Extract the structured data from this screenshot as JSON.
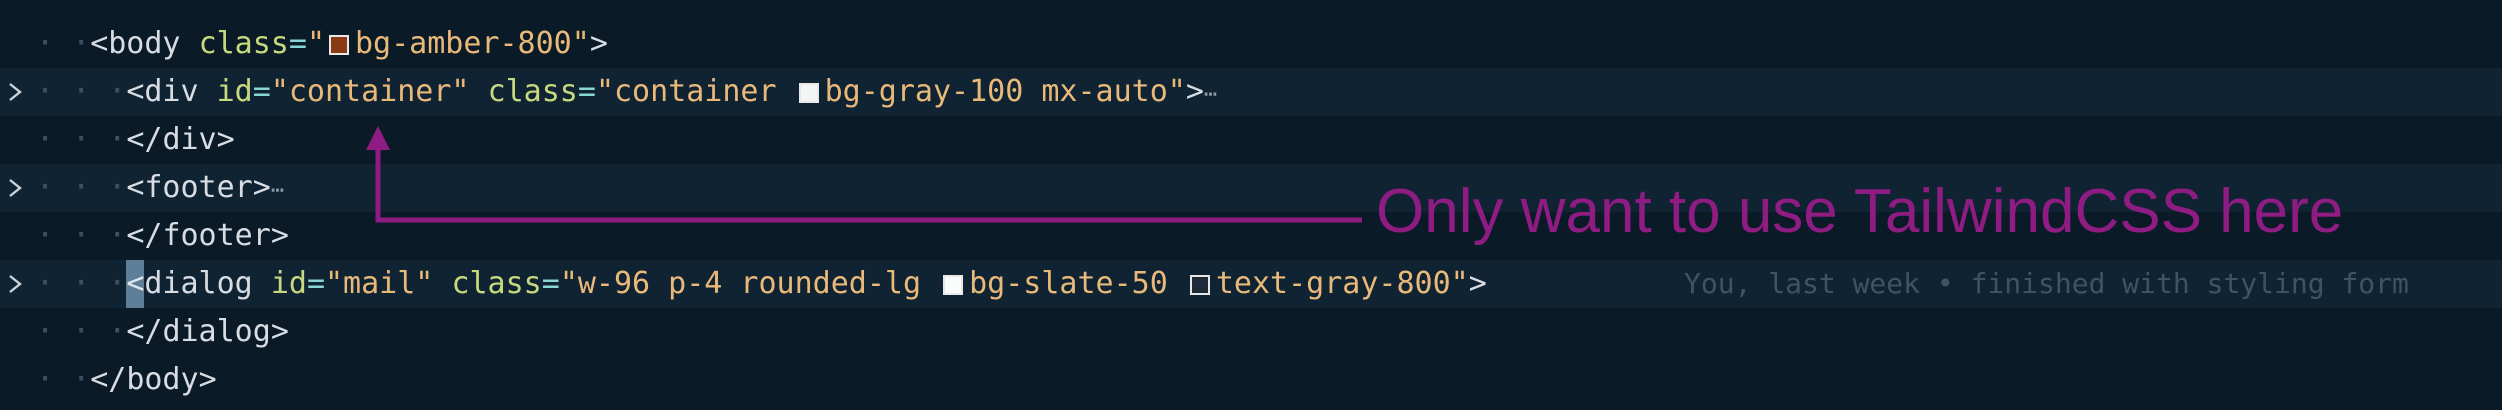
{
  "editor": {
    "lines": [
      {
        "pre": "<",
        "tag": "body",
        "a1": "class",
        "v1pre": "\"",
        "swatch": "#8a3b14",
        "v1": "bg-amber-800",
        "v1post": "\"",
        "post": ">"
      },
      {
        "pre": "<",
        "tag": "div",
        "a1": "id",
        "v1": "\"container\"",
        "a2": "class",
        "v2pre": "\"container ",
        "swatch": "#f3f4f6",
        "v2": "bg-gray-100 mx-auto",
        "v2post": "\"",
        "post": ">",
        "ellipsis": "⋯"
      },
      {
        "pre": "</",
        "tag": "div",
        "post": ">"
      },
      {
        "pre": "<",
        "tag": "footer",
        "post": ">",
        "ellipsis": "⋯"
      },
      {
        "pre": "</",
        "tag": "footer",
        "post": ">"
      },
      {
        "cursor": "<",
        "tag": "dialog",
        "a1": "id",
        "v1": "\"mail\"",
        "a2": "class",
        "v2pre": "\"w-96 p-4 rounded-lg ",
        "swatch1": "#f8fafc",
        "v2a": "bg-slate-50 ",
        "swatch2": "#1f2937",
        "v2b": "text-gray-800",
        "v2post": "\"",
        "post": ">"
      },
      {
        "pre": "</",
        "tag": "dialog",
        "post": ">"
      },
      {
        "pre": "</",
        "tag": "body",
        "post": ">"
      }
    ],
    "blame": "You, last week • finished with styling form",
    "indent_dots": "· ·",
    "indent_dots_deep": "· · ·"
  },
  "annotation": {
    "text": "Only want to use TailwindCSS here",
    "color": "#8e1c82"
  },
  "colors": {
    "background": "#0b1a27",
    "highlight_row": "#102332",
    "attribute": "#c7d97e",
    "string": "#e9b97a",
    "equals": "#89d6d6"
  }
}
